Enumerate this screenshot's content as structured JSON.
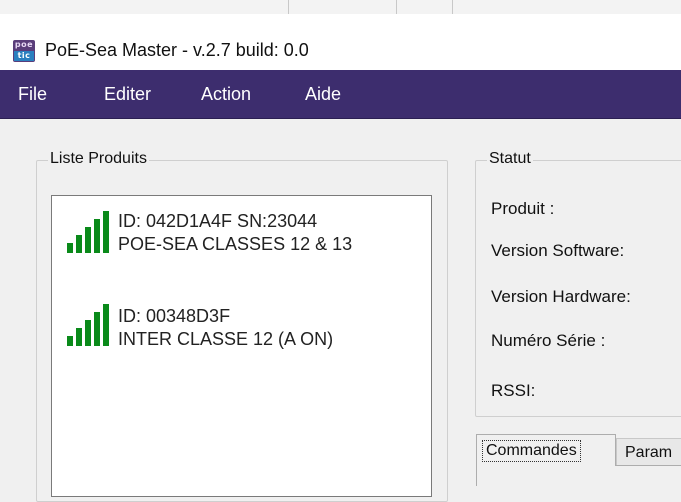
{
  "window": {
    "title": "PoE-Sea Master - v.2.7   build: 0.0",
    "icon": {
      "name": "poetic-app-icon",
      "top_text": "poe",
      "bottom_text": "tic"
    }
  },
  "menu": {
    "items": [
      "File",
      "Editer",
      "Action",
      "Aide"
    ]
  },
  "products": {
    "legend": "Liste Produits",
    "devices": [
      {
        "line1": "ID: 042D1A4F SN:23044",
        "line2": "POE-SEA CLASSES 12 & 13",
        "signal_bars": 5,
        "signal_color": "#0a8a1a"
      },
      {
        "line1": "ID: 00348D3F",
        "line2": "INTER CLASSE 12 (A ON)",
        "signal_bars": 5,
        "signal_color": "#0a8a1a"
      }
    ]
  },
  "status": {
    "legend": "Statut",
    "labels": [
      "Produit :",
      "Version Software:",
      "Version Hardware:",
      "Numéro Série :",
      "RSSI:"
    ]
  },
  "tabs": {
    "items": [
      "Commandes",
      "Param"
    ],
    "active": "Commandes"
  },
  "colors": {
    "menubar": "#3d2d6e",
    "signal": "#0a8a1a"
  }
}
